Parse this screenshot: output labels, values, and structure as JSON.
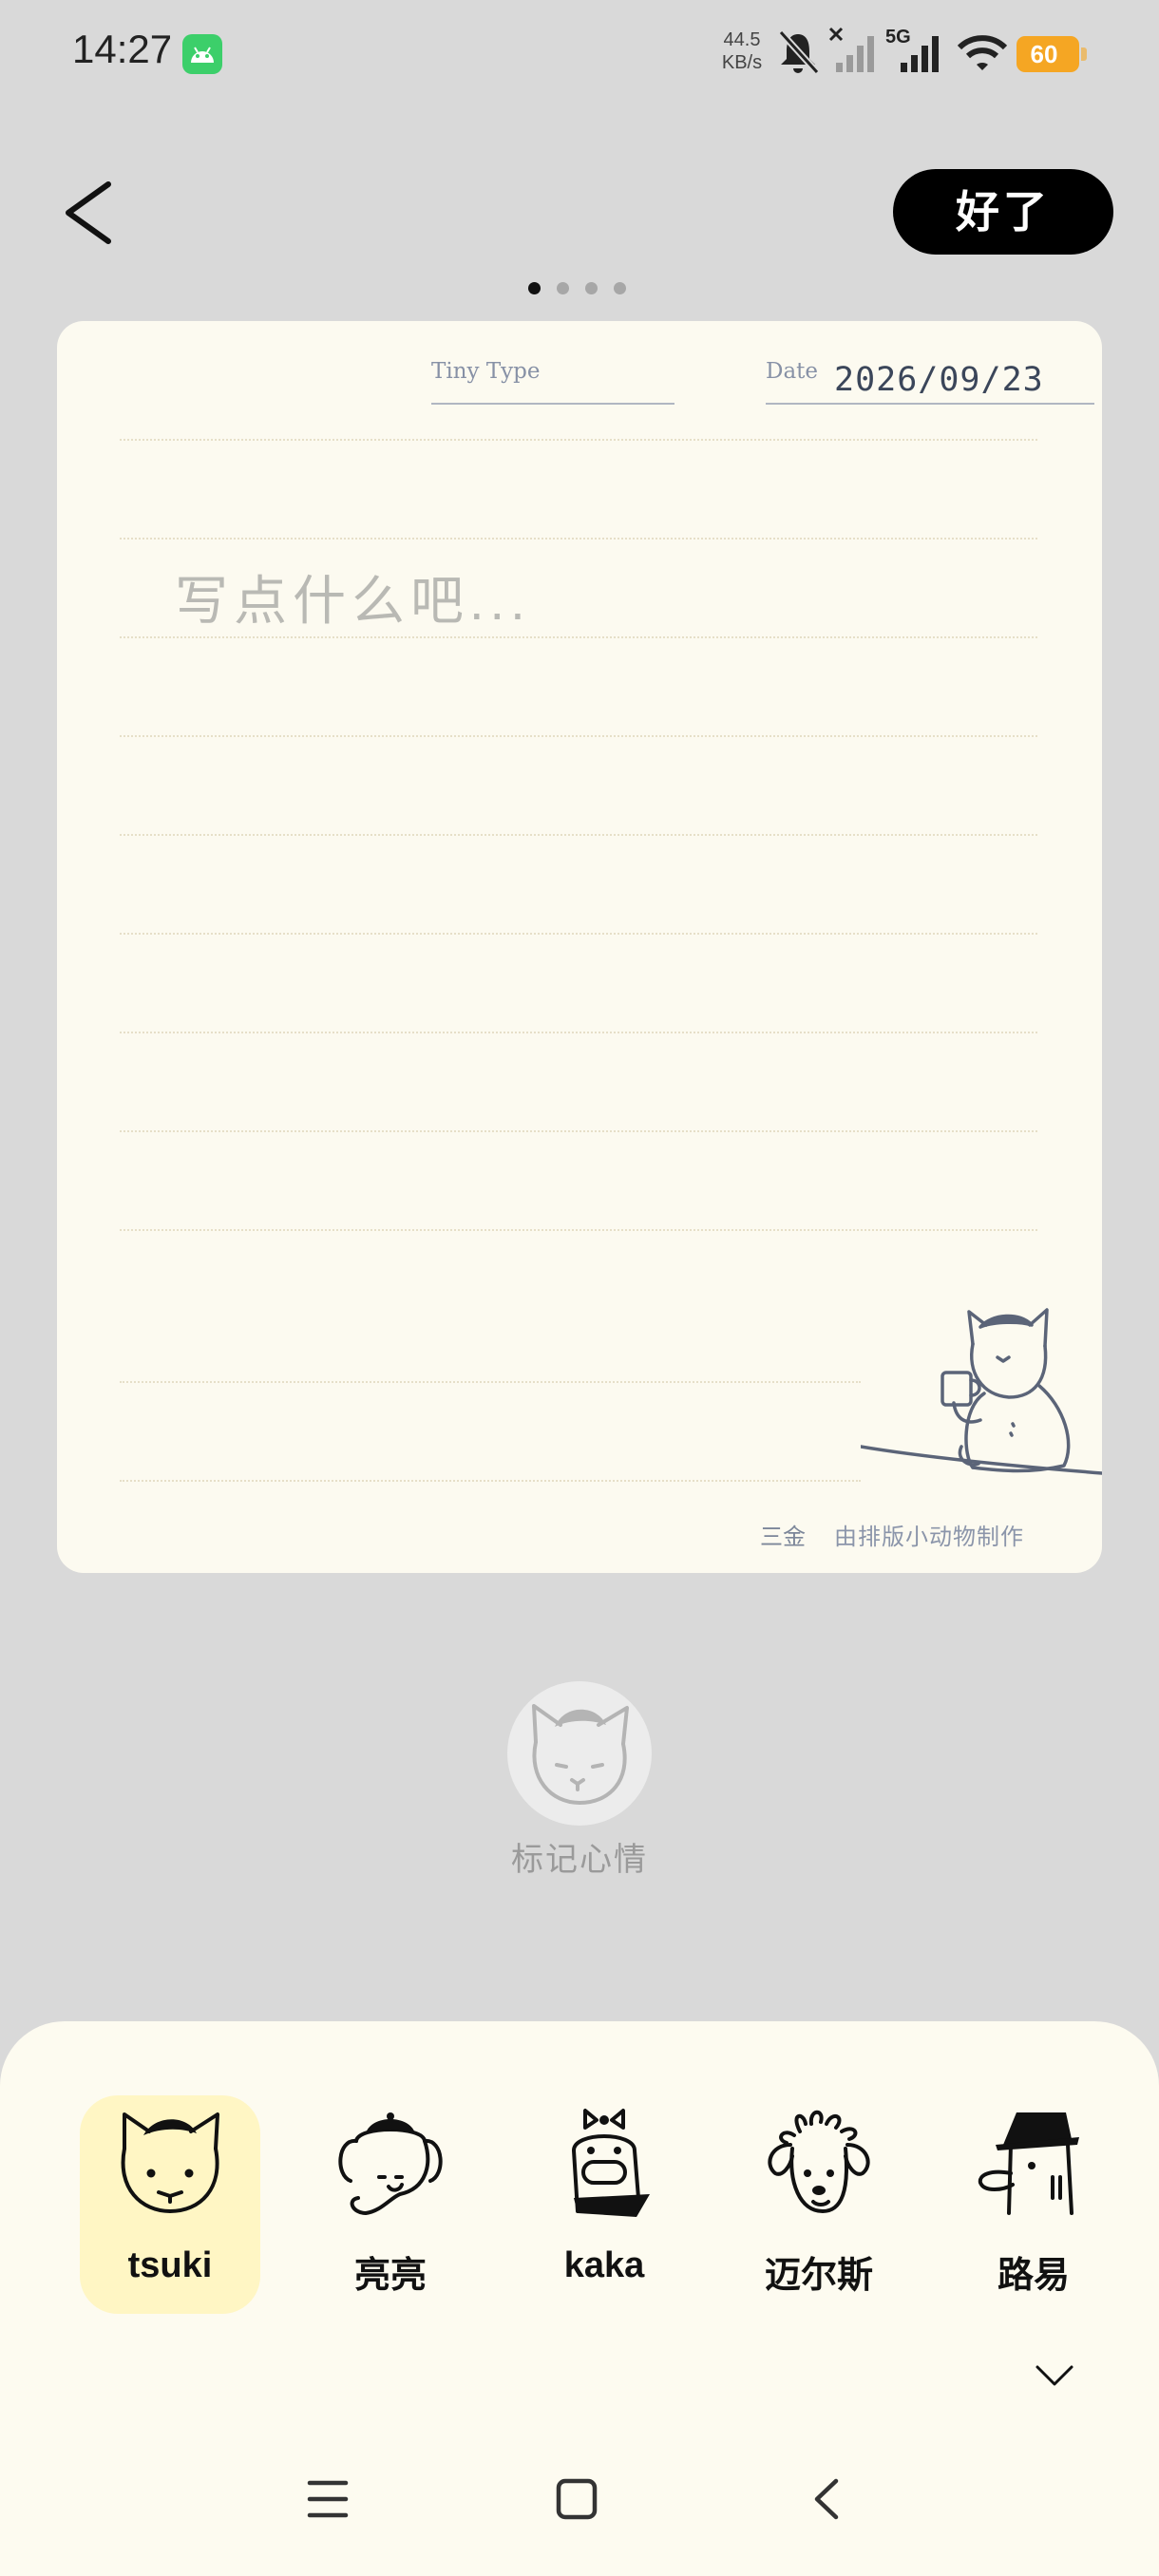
{
  "status_bar": {
    "time": "14:27",
    "net_speed_value": "44.5",
    "net_speed_unit": "KB/s",
    "network_type": "5G",
    "battery": "60",
    "battery_color": "#f5a623",
    "icons": [
      "android-app-icon",
      "mute-icon",
      "signal-no-sim-icon",
      "signal-5g-icon",
      "wifi-icon",
      "battery-icon"
    ]
  },
  "header": {
    "back_icon": "chevron-left-icon",
    "done_label": "好了",
    "pager": {
      "count": 4,
      "active": 0
    }
  },
  "paper": {
    "tiny_type_label": "Tiny Type",
    "date_label": "Date",
    "date_value": "2026/09/23",
    "placeholder": "写点什么吧...",
    "illustration": "cat-with-coffee-icon",
    "footer_author": "三金",
    "footer_credit": "由排版小动物制作"
  },
  "mood": {
    "icon": "cat-face-icon",
    "label": "标记心情"
  },
  "characters": [
    {
      "name": "tsuki",
      "icon": "cat-beret-icon",
      "selected": true
    },
    {
      "name": "亮亮",
      "icon": "elephant-beret-icon",
      "selected": false
    },
    {
      "name": "kaka",
      "icon": "duck-bow-icon",
      "selected": false
    },
    {
      "name": "迈尔斯",
      "icon": "curly-dog-icon",
      "selected": false
    },
    {
      "name": "路易",
      "icon": "duck-hat-icon",
      "selected": false
    }
  ],
  "sheet": {
    "collapse_icon": "chevron-down-icon"
  },
  "nav_bar": {
    "items": [
      "menu-icon",
      "home-icon",
      "back-icon"
    ]
  },
  "colors": {
    "background": "#d9d9d9",
    "paper": "#fcfaf0",
    "sheet": "#fdfbf0",
    "selected_highlight": "#fff6c4",
    "done_button": "#000000",
    "accent_text": "#8791a6"
  }
}
